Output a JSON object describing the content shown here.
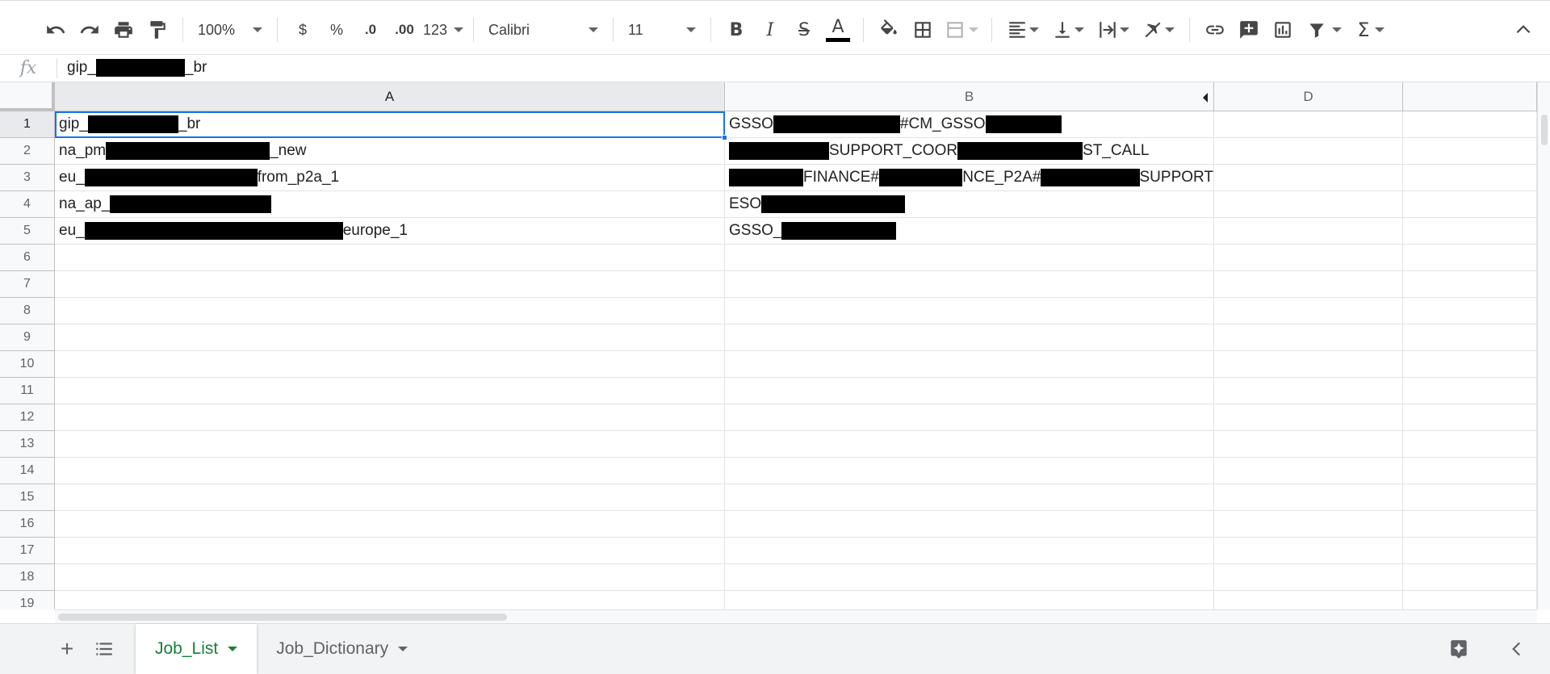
{
  "toolbar": {
    "zoom": "100%",
    "currency": "$",
    "percent": "%",
    "decrease_decimal": ".0",
    "increase_decimal": ".00",
    "number_format": "123",
    "font": "Calibri",
    "font_size": "11"
  },
  "formula_bar": {
    "fx": "fx",
    "value_prefix": "gip_",
    "value_suffix": "_br"
  },
  "columns": [
    "A",
    "B",
    "D"
  ],
  "row_numbers": [
    "1",
    "2",
    "3",
    "4",
    "5",
    "6",
    "7",
    "8",
    "9",
    "10",
    "11",
    "12",
    "13",
    "14",
    "15",
    "16",
    "17",
    "18",
    "19"
  ],
  "rows": [
    {
      "a": [
        "gip_",
        "_br"
      ],
      "b": [
        "GSSO",
        "#CM_GSSO",
        ""
      ]
    },
    {
      "a": [
        "na_pm",
        "_new"
      ],
      "b": [
        "",
        "SUPPORT_COOR",
        "ST_CALL"
      ]
    },
    {
      "a": [
        "eu_",
        "from_p2a_1"
      ],
      "b": [
        "",
        "FINANCE#",
        "NCE_P2A#",
        "SUPPORT"
      ]
    },
    {
      "a": [
        "na_ap_",
        ""
      ],
      "b": [
        "ESO",
        ""
      ]
    },
    {
      "a": [
        "eu_",
        "europe_1"
      ],
      "b": [
        "GSSO_",
        ""
      ]
    }
  ],
  "sheets": [
    {
      "name": "Job_List",
      "active": true
    },
    {
      "name": "Job_Dictionary",
      "active": false
    }
  ],
  "colors": {
    "accent": "#1a73e8",
    "active_tab": "#188038"
  }
}
